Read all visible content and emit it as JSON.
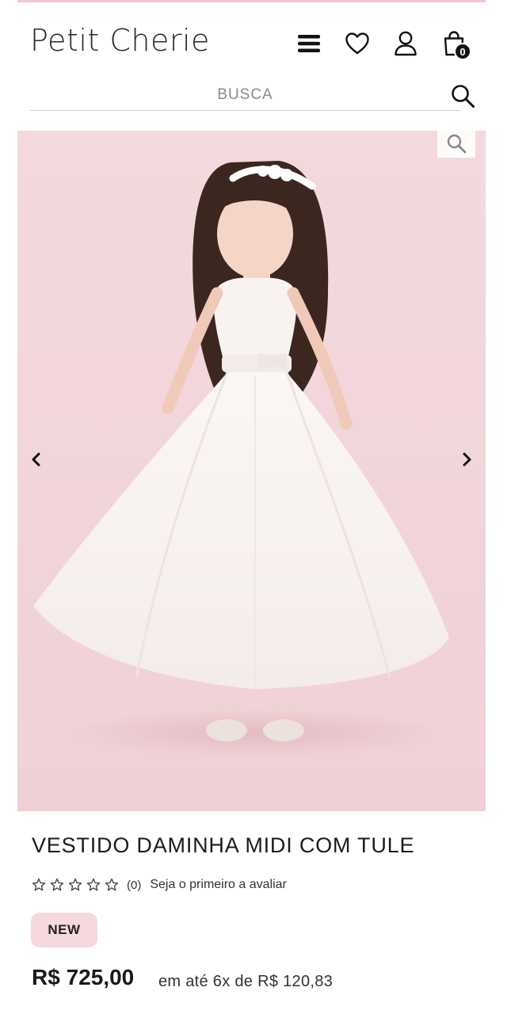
{
  "header": {
    "logo": "Petit Cherie",
    "cart_count": "0",
    "icons": {
      "menu": "hamburger-menu-icon",
      "wishlist": "heart-icon",
      "account": "user-icon",
      "cart": "shopping-bag-icon"
    }
  },
  "search": {
    "placeholder": "BUSCA",
    "icon": "search-icon"
  },
  "gallery": {
    "image_alt": "girl in a white tulle dress",
    "zoom_icon": "zoom-icon",
    "prev_icon": "chevron-left-icon",
    "next_icon": "chevron-right-icon"
  },
  "product": {
    "title": "VESTIDO DAMINHA MIDI COM TULE",
    "rating_stars": 0,
    "review_count": "(0)",
    "review_cta": "Seja o primeiro a avaliar",
    "badge": "NEW",
    "price": "R$ 725,00",
    "installments": "em até 6x de R$ 120,83"
  },
  "colors": {
    "accent_pink": "#f2c9cf",
    "badge_bg": "#f6d9dc",
    "gallery_bg": "#f2d6db",
    "text_dark": "#1c1c1c"
  }
}
